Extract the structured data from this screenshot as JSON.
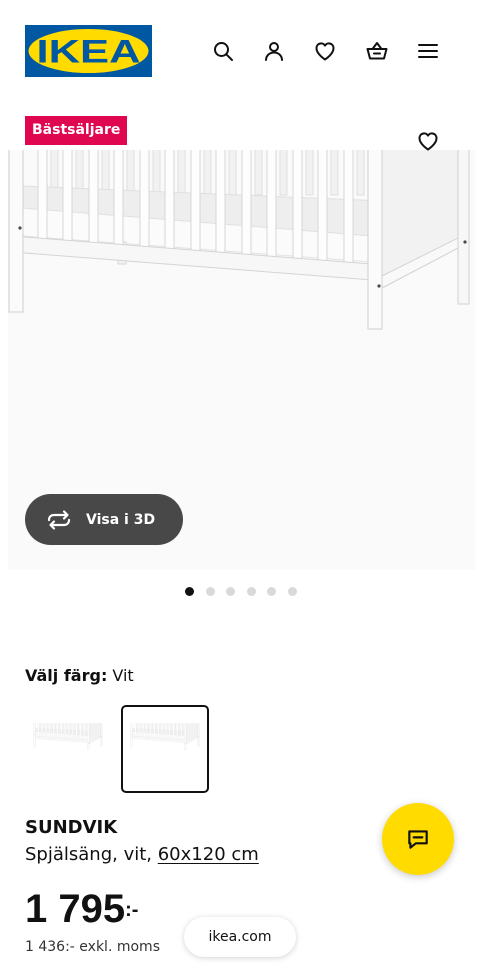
{
  "header": {
    "logo_text": "IKEA",
    "icons": {
      "search": "search-icon",
      "account": "person-icon",
      "wishlist": "heart-icon",
      "cart": "basket-icon",
      "menu": "menu-icon"
    }
  },
  "badge": {
    "label": "Bästsäljare"
  },
  "gallery": {
    "wishlist_icon": "heart-icon",
    "view_3d_label": "Visa i 3D",
    "view_3d_icon": "rotate-icon",
    "dot_count": 6,
    "active_dot": 0
  },
  "color_picker": {
    "label": "Välj färg:",
    "value": "Vit",
    "option_count": 2,
    "selected_index": 1
  },
  "product": {
    "name": "SUNDVIK",
    "description": "Spjälsäng, vit, ",
    "size_link": "60x120 cm"
  },
  "price": {
    "amount": "1 795",
    "suffix": ":-",
    "excl_vat": "1 436:- exkl. moms"
  },
  "chat_button": {
    "icon": "chat-icon"
  },
  "url_chip": {
    "text": "ikea.com"
  },
  "colors": {
    "brand_blue": "#0058A3",
    "brand_yellow": "#FFDB00",
    "badge_red": "#E00751",
    "button_dark": "#484848"
  }
}
